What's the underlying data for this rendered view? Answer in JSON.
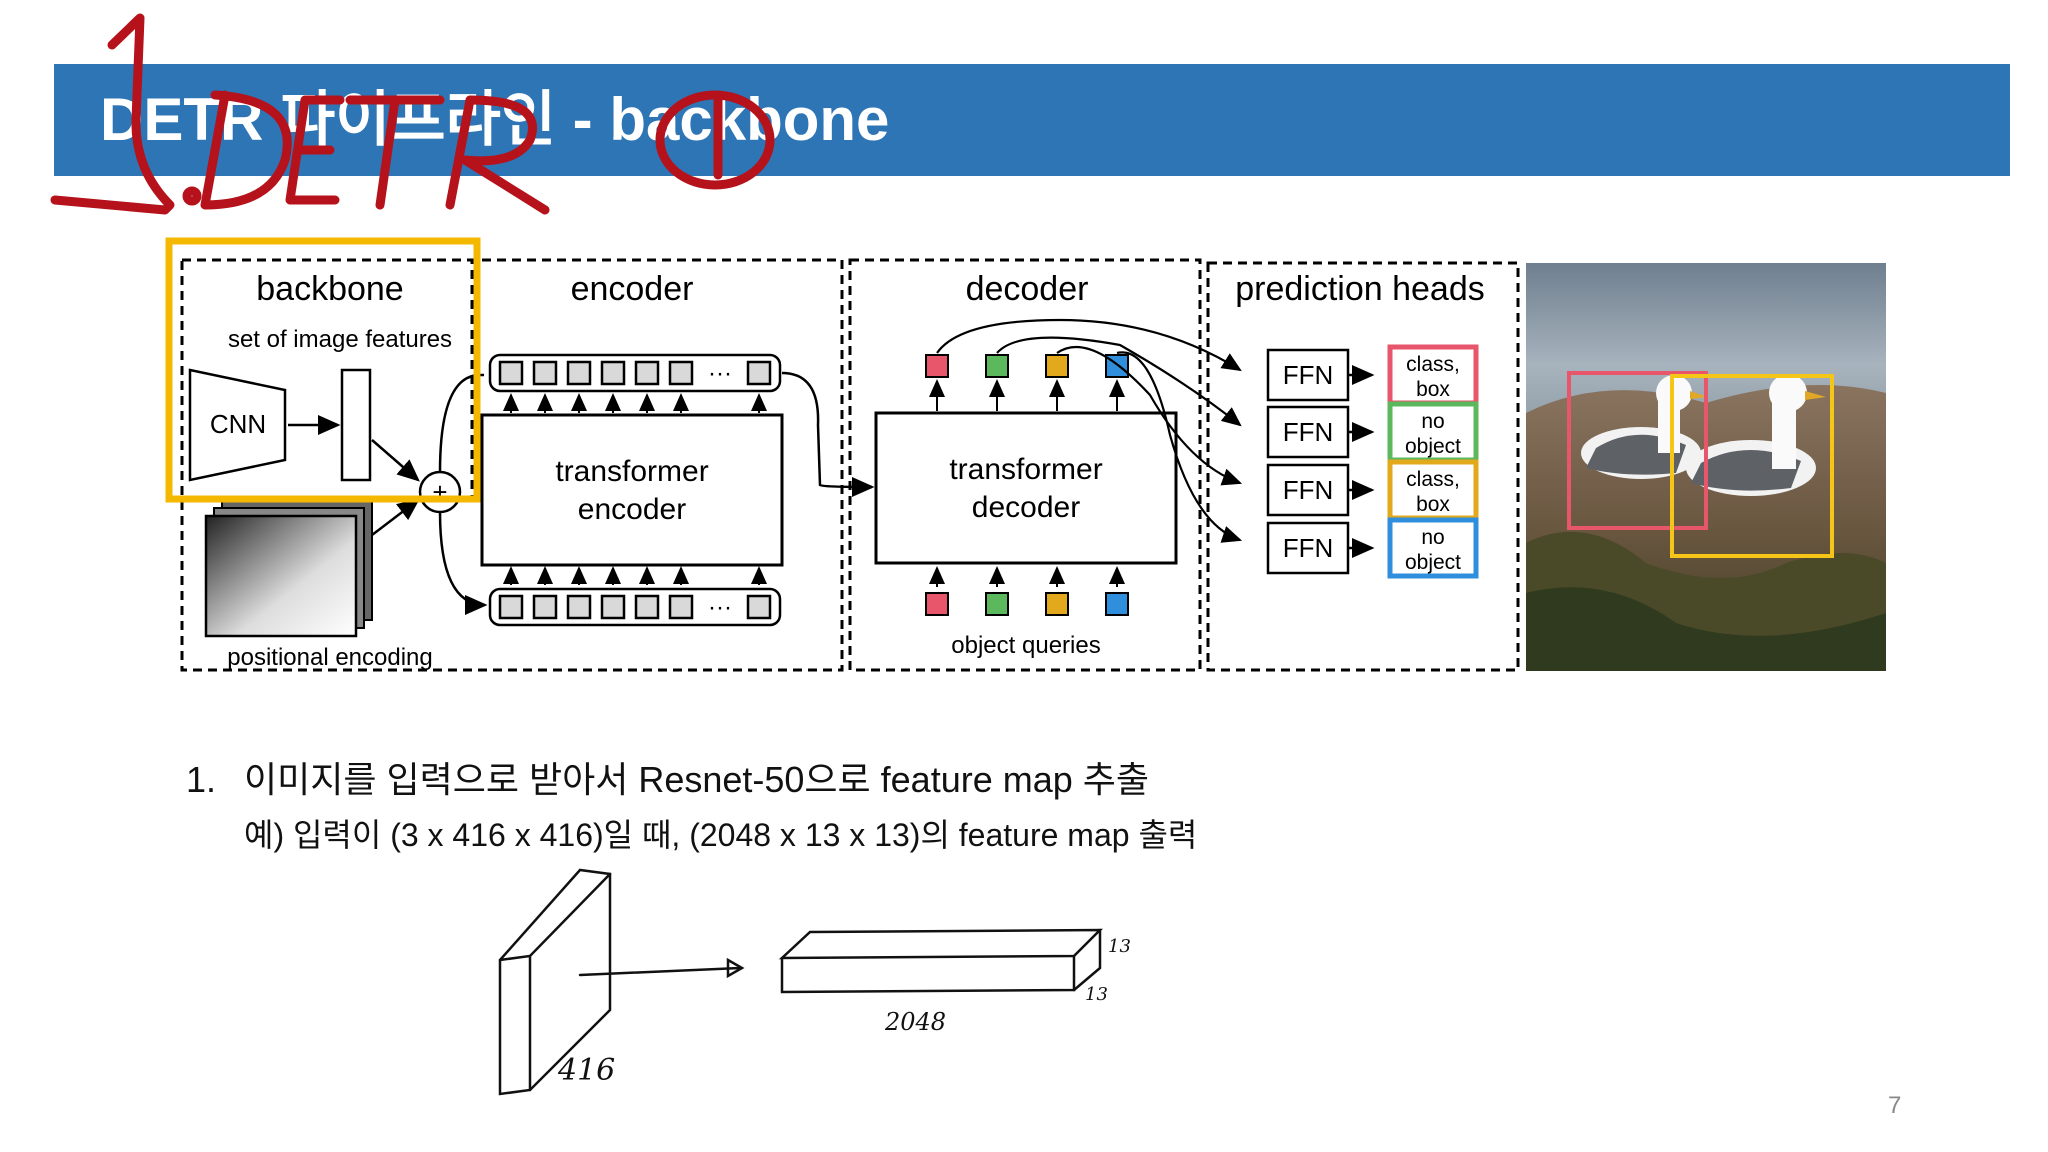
{
  "slide": {
    "title": "DETR 파이프라인 - backbone",
    "page_number": "7"
  },
  "annotation": {
    "handwritten": "1.DETR ①",
    "color": "#b5121b"
  },
  "diagram": {
    "sections": {
      "backbone": "backbone",
      "encoder": "encoder",
      "decoder": "decoder",
      "prediction_heads": "prediction heads"
    },
    "backbone_caption": "set of image features",
    "cnn_label": "CNN",
    "positional_encoding": "positional encoding",
    "encoder_box_line1": "transformer",
    "encoder_box_line2": "encoder",
    "decoder_box_line1": "transformer",
    "decoder_box_line2": "decoder",
    "object_queries": "object queries",
    "ellipsis": "···",
    "plus": "+",
    "ffn_label": "FFN",
    "outputs": [
      {
        "line1": "class,",
        "line2": "box",
        "color": "#e8566c"
      },
      {
        "line1": "no",
        "line2": "object",
        "color": "#5cb85c"
      },
      {
        "line1": "class,",
        "line2": "box",
        "color": "#e2a91c"
      },
      {
        "line1": "no",
        "line2": "object",
        "color": "#2f8fdd"
      }
    ],
    "query_colors": [
      "#e8566c",
      "#5cb85c",
      "#e2a91c",
      "#2f8fdd"
    ],
    "highlight_color": "#f5b800"
  },
  "body": {
    "item_number": "1.",
    "item_text": "이미지를 입력으로 받아서 Resnet-50으로 feature map 추출",
    "example": "예) 입력이 (3 x 416 x 416)일 때, (2048 x 13 x 13)의 feature map 출력"
  },
  "sketch": {
    "input_label": "416",
    "output_width_label": "2048",
    "output_height_label": "13",
    "output_depth_label": "13"
  }
}
